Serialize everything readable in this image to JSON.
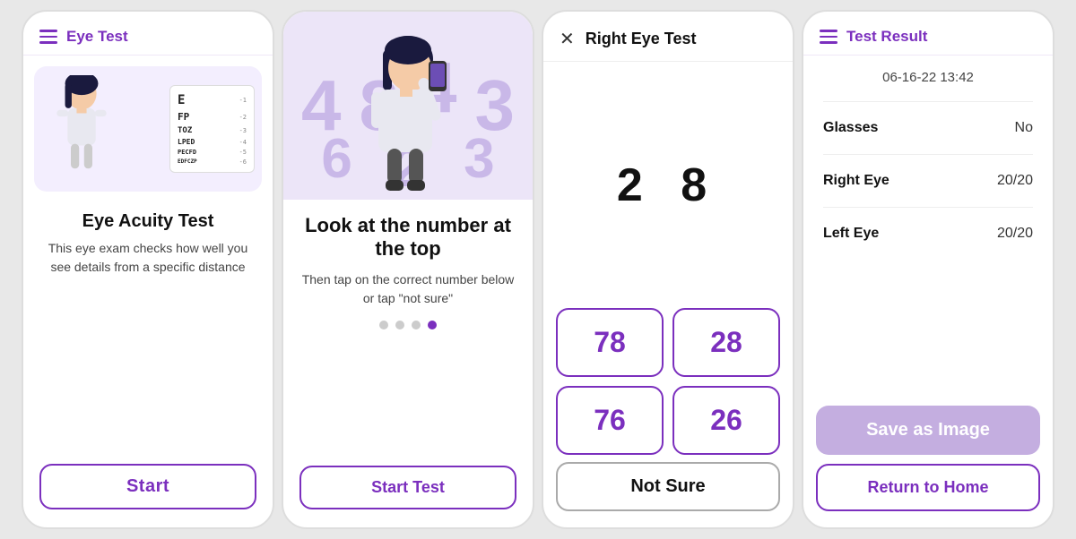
{
  "screen1": {
    "app_title": "Eye Test",
    "heading": "Eye Acuity Test",
    "description": "This eye exam checks how well you see details from a specific distance",
    "start_button": "Start",
    "eye_chart": [
      {
        "letters": "E",
        "num": "-1"
      },
      {
        "letters": "FP",
        "num": "-2"
      },
      {
        "letters": "TOZ",
        "num": "-3"
      },
      {
        "letters": "LPED",
        "num": "-4"
      },
      {
        "letters": "PECFD",
        "num": "-5"
      },
      {
        "letters": "EDFCZP",
        "num": "-6"
      }
    ]
  },
  "screen2": {
    "bg_numbers": [
      "4",
      "8",
      "4",
      "3"
    ],
    "bottom_numbers": [
      "6",
      "2",
      "3"
    ],
    "heading": "Look at the number at the top",
    "subtext": "Then tap on the correct number below or tap \"not sure\"",
    "dots": [
      false,
      false,
      false,
      true
    ],
    "start_button": "Start Test"
  },
  "screen3": {
    "title": "Right Eye Test",
    "display": "2   8",
    "choices": [
      "78",
      "28",
      "76",
      "26"
    ],
    "not_sure": "Not Sure"
  },
  "screen4": {
    "title": "Test Result",
    "date": "06-16-22 13:42",
    "rows": [
      {
        "label": "Glasses",
        "value": "No"
      },
      {
        "label": "Right Eye",
        "value": "20/20"
      },
      {
        "label": "Left Eye",
        "value": "20/20"
      }
    ],
    "save_button": "Save as Image",
    "home_button": "Return to Home"
  }
}
